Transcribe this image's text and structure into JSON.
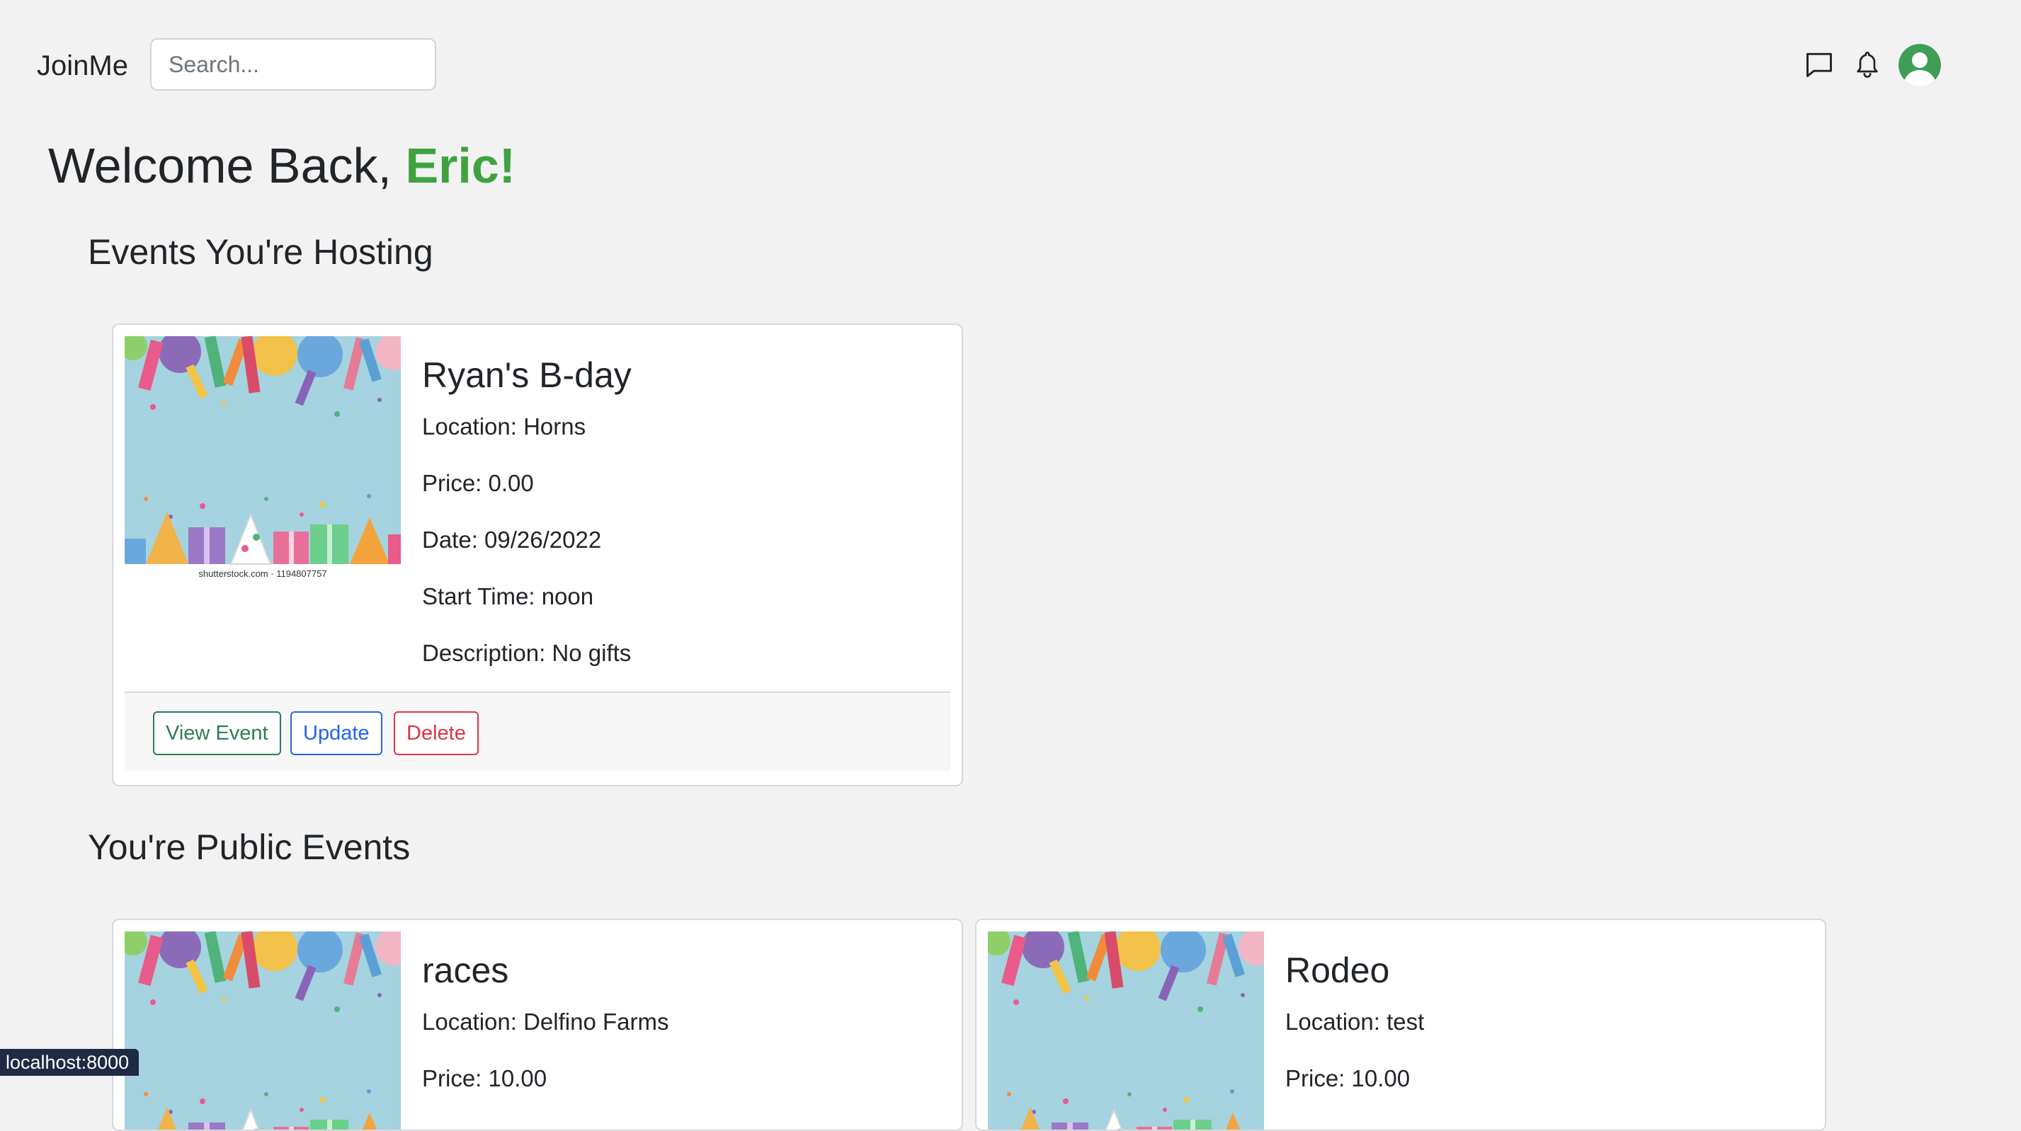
{
  "navbar": {
    "brand": "JoinMe",
    "search_placeholder": "Search...",
    "icons": [
      "chat-icon",
      "bell-icon",
      "user-avatar-icon"
    ]
  },
  "welcome": {
    "prefix": "Welcome Back,",
    "name": "Eric!"
  },
  "hosting": {
    "heading": "Events You're Hosting",
    "events": [
      {
        "title": "Ryan's B-day",
        "location": "Location: Horns",
        "price": "Price: 0.00",
        "date": "Date: 09/26/2022",
        "start_time": "Start Time: noon",
        "description": "Description: No gifts",
        "image_caption": "shutterstock.com · 1194807757",
        "buttons": {
          "view": "View Event",
          "update": "Update",
          "delete": "Delete"
        }
      }
    ]
  },
  "public": {
    "heading": "You're Public Events",
    "events": [
      {
        "title": "races",
        "location": "Location: Delfino Farms",
        "price": "Price: 10.00"
      },
      {
        "title": "Rodeo",
        "location": "Location: test",
        "price": "Price: 10.00"
      }
    ]
  },
  "status_bar": {
    "url": "localhost:8000"
  },
  "colors": {
    "accent_green": "#3fa23f",
    "page_bg": "#f2f2f2",
    "view_button": "#2e7d4f",
    "update_button": "#2563eb",
    "delete_button": "#dc3545"
  }
}
